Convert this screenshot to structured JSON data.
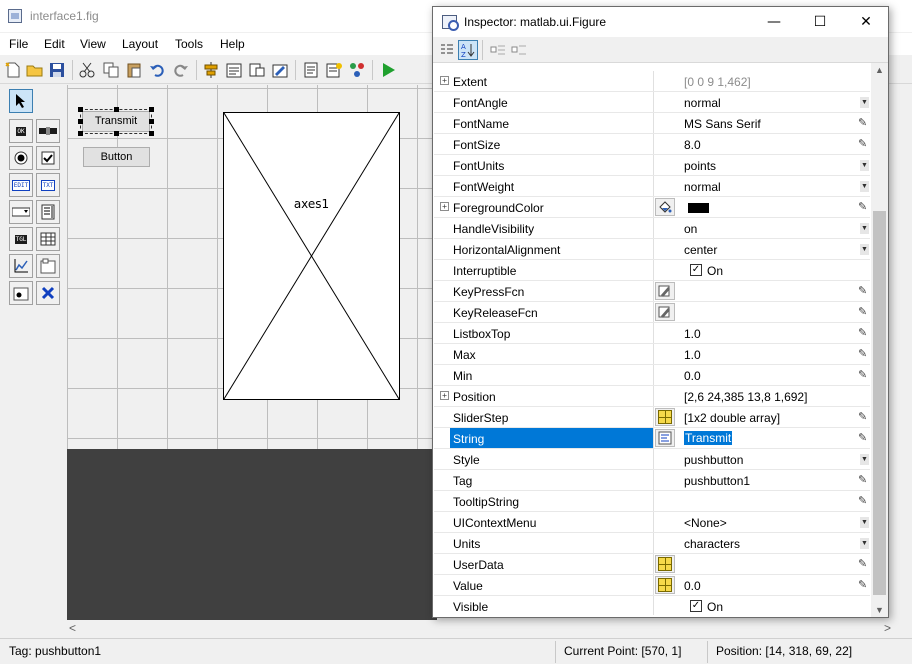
{
  "guide": {
    "title": "interface1.fig",
    "menu": [
      "File",
      "Edit",
      "View",
      "Layout",
      "Tools",
      "Help"
    ],
    "canvas": {
      "transmit_label": "Transmit",
      "button_label": "Button",
      "axes_label": "axes1"
    },
    "status": {
      "tag": "Tag: pushbutton1",
      "current_point": "Current Point:  [570, 1]",
      "position": "Position: [14, 318, 69, 22]"
    }
  },
  "inspector": {
    "title": "Inspector:  matlab.ui.Figure",
    "controls": {
      "minimize": "—",
      "maximize": "☐",
      "close": "✕"
    },
    "properties": [
      {
        "name": "Extent",
        "value": "[0 0 9 1,462]",
        "expand": true,
        "muted": true,
        "editor": ""
      },
      {
        "name": "FontAngle",
        "value": "normal",
        "editor": "dropdown"
      },
      {
        "name": "FontName",
        "value": "MS Sans Serif",
        "editor": "pencil"
      },
      {
        "name": "FontSize",
        "value": "8.0",
        "editor": "pencil"
      },
      {
        "name": "FontUnits",
        "value": "points",
        "editor": "dropdown"
      },
      {
        "name": "FontWeight",
        "value": "normal",
        "editor": "dropdown"
      },
      {
        "name": "ForegroundColor",
        "value": "",
        "expand": true,
        "icon": "paint-bucket",
        "swatch": "#000000",
        "editor": "pencil"
      },
      {
        "name": "HandleVisibility",
        "value": "on",
        "editor": "dropdown"
      },
      {
        "name": "HorizontalAlignment",
        "value": "center",
        "editor": "dropdown"
      },
      {
        "name": "Interruptible",
        "value": "On",
        "checkbox": true,
        "editor": ""
      },
      {
        "name": "KeyPressFcn",
        "value": "",
        "icon": "callback",
        "editor": "pencil"
      },
      {
        "name": "KeyReleaseFcn",
        "value": "",
        "icon": "callback",
        "editor": "pencil"
      },
      {
        "name": "ListboxTop",
        "value": "1.0",
        "editor": "pencil"
      },
      {
        "name": "Max",
        "value": "1.0",
        "editor": "pencil"
      },
      {
        "name": "Min",
        "value": "0.0",
        "editor": "pencil"
      },
      {
        "name": "Position",
        "value": "[2,6 24,385 13,8 1,692]",
        "expand": true,
        "editor": ""
      },
      {
        "name": "SliderStep",
        "value": "[1x2  double array]",
        "icon": "array",
        "editor": "pencil"
      },
      {
        "name": "String",
        "value": "Transmit",
        "icon": "text",
        "selected": true,
        "editor": "pencil"
      },
      {
        "name": "Style",
        "value": "pushbutton",
        "editor": "dropdown"
      },
      {
        "name": "Tag",
        "value": "pushbutton1",
        "editor": "pencil"
      },
      {
        "name": "TooltipString",
        "value": "",
        "editor": "pencil"
      },
      {
        "name": "UIContextMenu",
        "value": "<None>",
        "editor": "dropdown"
      },
      {
        "name": "Units",
        "value": "characters",
        "editor": "dropdown"
      },
      {
        "name": "UserData",
        "value": "",
        "icon": "array",
        "editor": "pencil"
      },
      {
        "name": "Value",
        "value": "0.0",
        "icon": "array",
        "editor": "pencil"
      },
      {
        "name": "Visible",
        "value": "On",
        "checkbox": true,
        "editor": ""
      }
    ]
  },
  "colors": {
    "selection": "#0078d7",
    "canvas_background": "#404040"
  }
}
